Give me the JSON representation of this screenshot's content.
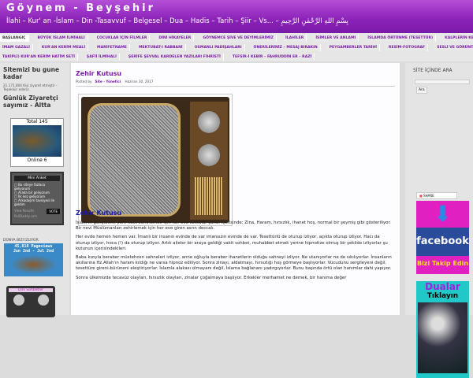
{
  "header": {
    "title": "Göynem - Beyşehir",
    "subtitle": "İlahi – Kur' an -İslam – Din -Tasavvuf – Belgesel – Dua – Hadis – Tarih – Şiir – Vs... – بِسْمِ اللهِ الرَّحْمٰنِ الرَّحِيمِ"
  },
  "nav": {
    "row1": [
      "BAŞLANGIÇ",
      "BÜYÜK İSLAM İLMİHALİ",
      "ÇOCUKLAR İÇİN FİLMLER",
      "DİNİ HİKAYELER",
      "GÖYNEMCE ŞİVE VE DEYİMLERİMİZ",
      "İLAHİLER",
      "İSİMLER VE ANLAMI",
      "İSLAMDA ÖRTÜNME (TESETTÜR)",
      "KALPLERİN KEŞFİ -"
    ],
    "row2": [
      "İMAM GAZALİ",
      "KUR'AN KERİM MEALİ",
      "MARİFETNAME",
      "MEKTUBAT-I RABBANİ",
      "OSMANLI PADİŞAHLARI",
      "ÖNERİLERİNİZ – MESAJ BIRAKIN",
      "PEYGAMBERLER TARİHİ",
      "RESİM-FOTOGRAF",
      "SESLİ VE GÖRÜNTÜLÜ ("
    ],
    "row3": [
      "TAKİPLİ) KUR'AN KERİM HATİM SETİ",
      "ŞAFİİ İLMİHALİ",
      "ŞERİFE ŞEVVAL KARDELEN YAZILARI FİHRİSTİ",
      "TEFSİR-İ KEBİR – FAHRUDDİN ER – RAZİ"
    ]
  },
  "left": {
    "w1_title": "Sitemizi bu gune kadar",
    "w1_text": "21.171.804 Kişi ziyaret etmiştir - Teşekkür ederiz.",
    "w2_title": "Günlük Ziyaretçi sayımız - Altta",
    "map_total": "Total 145",
    "map_online": "Online 6",
    "poll_title": "Mini Anket",
    "poll_options": [
      "Bu siteye fazlaca geliyorum",
      "Arada bir geliyorum",
      "İlk kez geliyorum",
      "Arkadaşım tavsiyesi ile geldim"
    ],
    "poll_results": "View Results",
    "poll_vote": "VOTE",
    "poll_brand": "PollDaddy.com",
    "world_label": "DÜNYA BİZİ İZLİYOR",
    "pageviews": "45,818 Pageviews",
    "dates": "Jun 2nd - Jul 2nd",
    "radio_label": "Dini Sohbetler"
  },
  "post": {
    "title": "Zehir Kutusu",
    "posted_by": "Posted by",
    "author": "Site - Yönetici",
    "date": "Haziran 30, 2017",
    "heading": "Zehir Kutusu",
    "paragraphs": [
      "İslam'ın gençlerini, yeni nesli zehirlemek için her eve soktular şunu. İçerisinde; Zina, Haram, hırsızlık, ihanet hoş, normal bir şeymiş gibi gösteriliyor. Bir nevi Müslümanları zehirlemek için her eve giren asrın deccalı.",
      "Her evde hemen hemen var. İmanlı bir insanın evinde de var imansızın evinde de var. Tesettürlü de oturup izliyor, açıkta oturup izliyor. Hacı da oturup izliyor, hoca (!) da oturup izliyor. Artık aileler bir araya geldiği vakit sohbet, muhabbet etmek yerine hipnotize olmuş bir şekilde izliyorlar şu kutunun içerisindekileri.",
      "Baba kızıyla beraber müstehcen sahneleri izliyor, anne oğluyla beraber ihanetlerin olduğu sahneyi izliyor. Ne utanıyorlar ne de sıkılıyorlar. İnsanların akıllarına Hz.Allah'ın haram kıldığı ne varsa hipnoz ediliyor. Sonra zinayı, aldatmayı, hırsızlığı hoş görmeye başlıyorlar. Vücudunu sergileyeni değil, tesettüre gireni-bürüneni eleştiriyorlar. İslamla alakası olmayanı değil, İslama bağlananı yadırgıyorlar. Bunu başında örtü olan hanımlar dahi yapıyor.",
      "Sonra ülkemizde tecavüz olayları, hırsızlık olayları, zinalar çoğalmaya başlıyor. Erkekler merhamet ne demek, bir hanıma değer"
    ]
  },
  "right": {
    "title": "SİTE İÇİNDE ARA",
    "search_button": "Ara",
    "share": "SHARE",
    "fb_brand": "facebook",
    "fb_follow": "Bizi Takip Edin",
    "dua1": "Dualar",
    "dua2": "Tıklayın"
  }
}
